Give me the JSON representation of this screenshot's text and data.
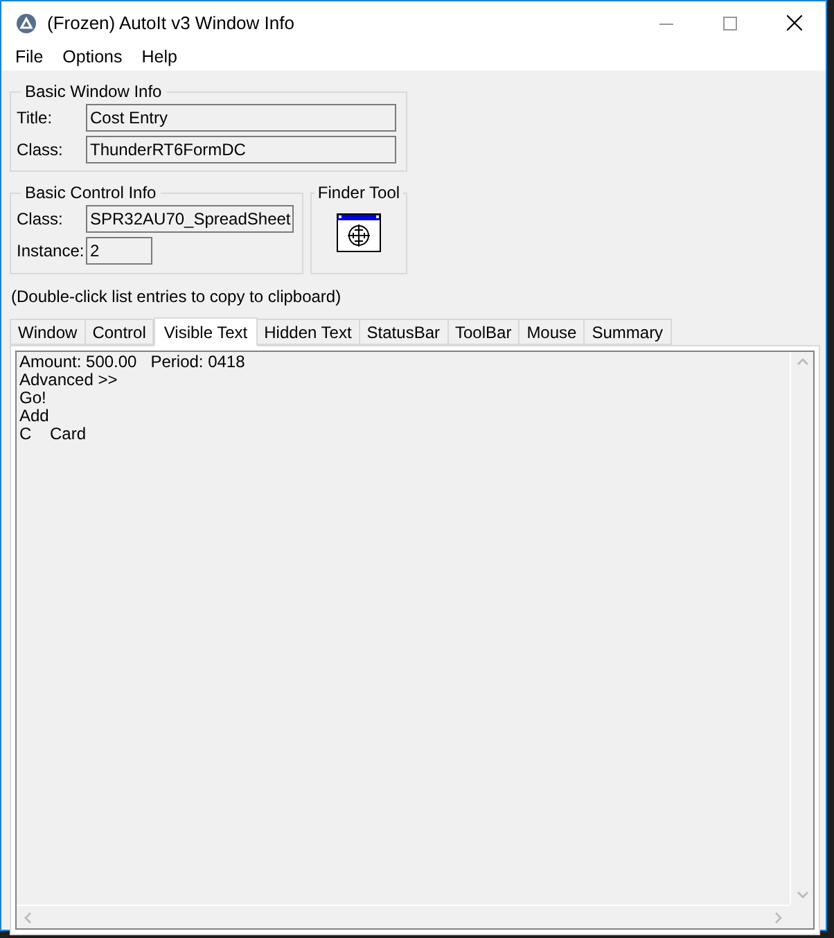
{
  "window": {
    "title": "(Frozen) AutoIt v3 Window Info"
  },
  "menu": [
    "File",
    "Options",
    "Help"
  ],
  "basic_window_info": {
    "label": "Basic Window Info",
    "fields": [
      {
        "label": "Title:",
        "value": "Cost Entry"
      },
      {
        "label": "Class:",
        "value": "ThunderRT6FormDC"
      }
    ]
  },
  "basic_control_info": {
    "label": "Basic Control Info",
    "fields": [
      {
        "label": "Class:",
        "value": "SPR32AU70_SpreadSheet"
      },
      {
        "label": "Instance:",
        "value": "2"
      }
    ]
  },
  "finder_tool": {
    "label": "Finder Tool"
  },
  "hint": "(Double-click list entries to copy to clipboard)",
  "tabs": [
    {
      "label": "Window",
      "selected": false
    },
    {
      "label": "Control",
      "selected": false
    },
    {
      "label": "Visible Text",
      "selected": true
    },
    {
      "label": "Hidden Text",
      "selected": false
    },
    {
      "label": "StatusBar",
      "selected": false
    },
    {
      "label": "ToolBar",
      "selected": false
    },
    {
      "label": "Mouse",
      "selected": false
    },
    {
      "label": "Summary",
      "selected": false
    }
  ],
  "list": [
    "Amount: 500.00   Period: 0418",
    "Advanced >>",
    "Go!",
    "Add",
    "C    Card"
  ]
}
